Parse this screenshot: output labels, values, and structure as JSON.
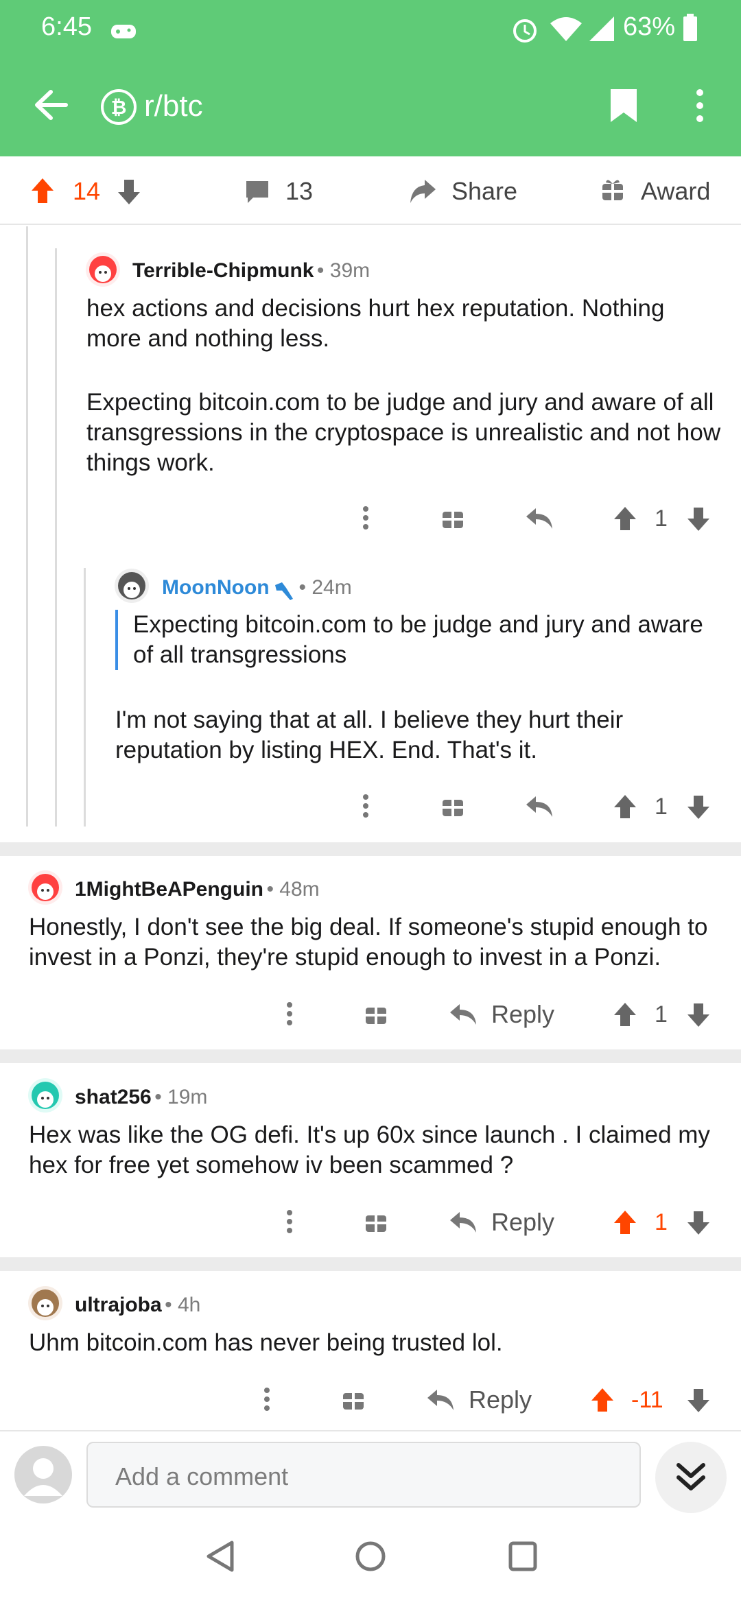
{
  "status_bar": {
    "time": "6:45",
    "battery": "63%"
  },
  "app_bar": {
    "title": "r/btc"
  },
  "post_actions": {
    "upvotes": "14",
    "comments": "13",
    "share_label": "Share",
    "award_label": "Award"
  },
  "comments": [
    {
      "author": "Terrible-Chipmunk",
      "time": "39m",
      "body": [
        "hex actions and decisions hurt hex reputation.  Nothing more and nothing less.",
        "Expecting bitcoin.com to be judge and jury and aware of all transgressions in the cryptospace is unrealistic and not how things work."
      ],
      "score": "1"
    },
    {
      "author": "MoonNoon",
      "time": "24m",
      "quote": "Expecting bitcoin.com to be judge and jury and aware of all transgressions",
      "body": "I'm not saying that at all. I believe they hurt their reputation by listing HEX. End. That's it.",
      "score": "1"
    },
    {
      "author": "1MightBeAPenguin",
      "time": "48m",
      "body": "Honestly, I don't see the big deal. If someone's stupid enough to invest in a Ponzi, they're stupid enough to invest in a Ponzi.",
      "reply_label": "Reply",
      "score": "1"
    },
    {
      "author": "shat256",
      "time": "19m",
      "body": "Hex was like the OG defi. It's up 60x since launch . I claimed my hex for free yet somehow iv been scammed ?",
      "reply_label": "Reply",
      "score": "1"
    },
    {
      "author": "ultrajoba",
      "time": "4h",
      "body": "Uhm bitcoin.com has never being trusted lol.",
      "reply_label": "Reply",
      "score": "-11"
    }
  ],
  "comment_input": {
    "placeholder": "Add a comment"
  },
  "colors": {
    "app_bar": "#5fcb77",
    "upvote_active": "#ff4500",
    "mod_blue": "#2e8ad8"
  }
}
